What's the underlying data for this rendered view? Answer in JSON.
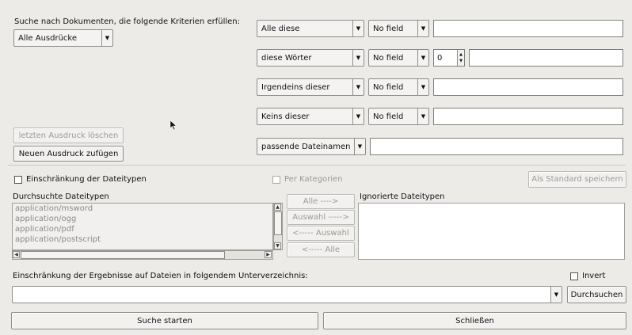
{
  "criteria": {
    "heading": "Suche nach Dokumenten, die folgende Kriterien erfüllen:",
    "expression_mode": "Alle Ausdrücke",
    "delete_expr_label": "letzten Ausdruck löschen",
    "add_expr_label": "Neuen Ausdruck zufügen",
    "rows": [
      {
        "type": "Alle diese",
        "field": "No field",
        "value": ""
      },
      {
        "type": "diese Wörter",
        "field": "No field",
        "proximity": "0",
        "value": ""
      },
      {
        "type": "Irgendeins dieser",
        "field": "No field",
        "value": ""
      },
      {
        "type": "Keins dieser",
        "field": "No field",
        "value": ""
      },
      {
        "type": "passende Dateinamen",
        "value": ""
      }
    ]
  },
  "filetypes": {
    "restrict_label": "Einschränkung der Dateitypen",
    "by_category_label": "Per Kategorien",
    "save_default_label": "Als Standard speichern",
    "searched_label": "Durchsuchte Dateitypen",
    "searched_items": [
      "application/msword",
      "application/ogg",
      "application/pdf",
      "application/postscript"
    ],
    "ignored_label": "Ignorierte Dateitypen",
    "ignored_items": [],
    "all_right_label": "Alle ---->",
    "sel_right_label": "Auswahl ----->",
    "sel_left_label": "<----- Auswahl",
    "all_left_label": "<----- Alle"
  },
  "directory": {
    "label": "Einschränkung der Ergebnisse auf Dateien in folgendem Unterverzeichnis:",
    "invert_label": "Invert",
    "value": "",
    "browse_label": "Durchsuchen"
  },
  "actions": {
    "start_label": "Suche starten",
    "close_label": "Schließen"
  }
}
